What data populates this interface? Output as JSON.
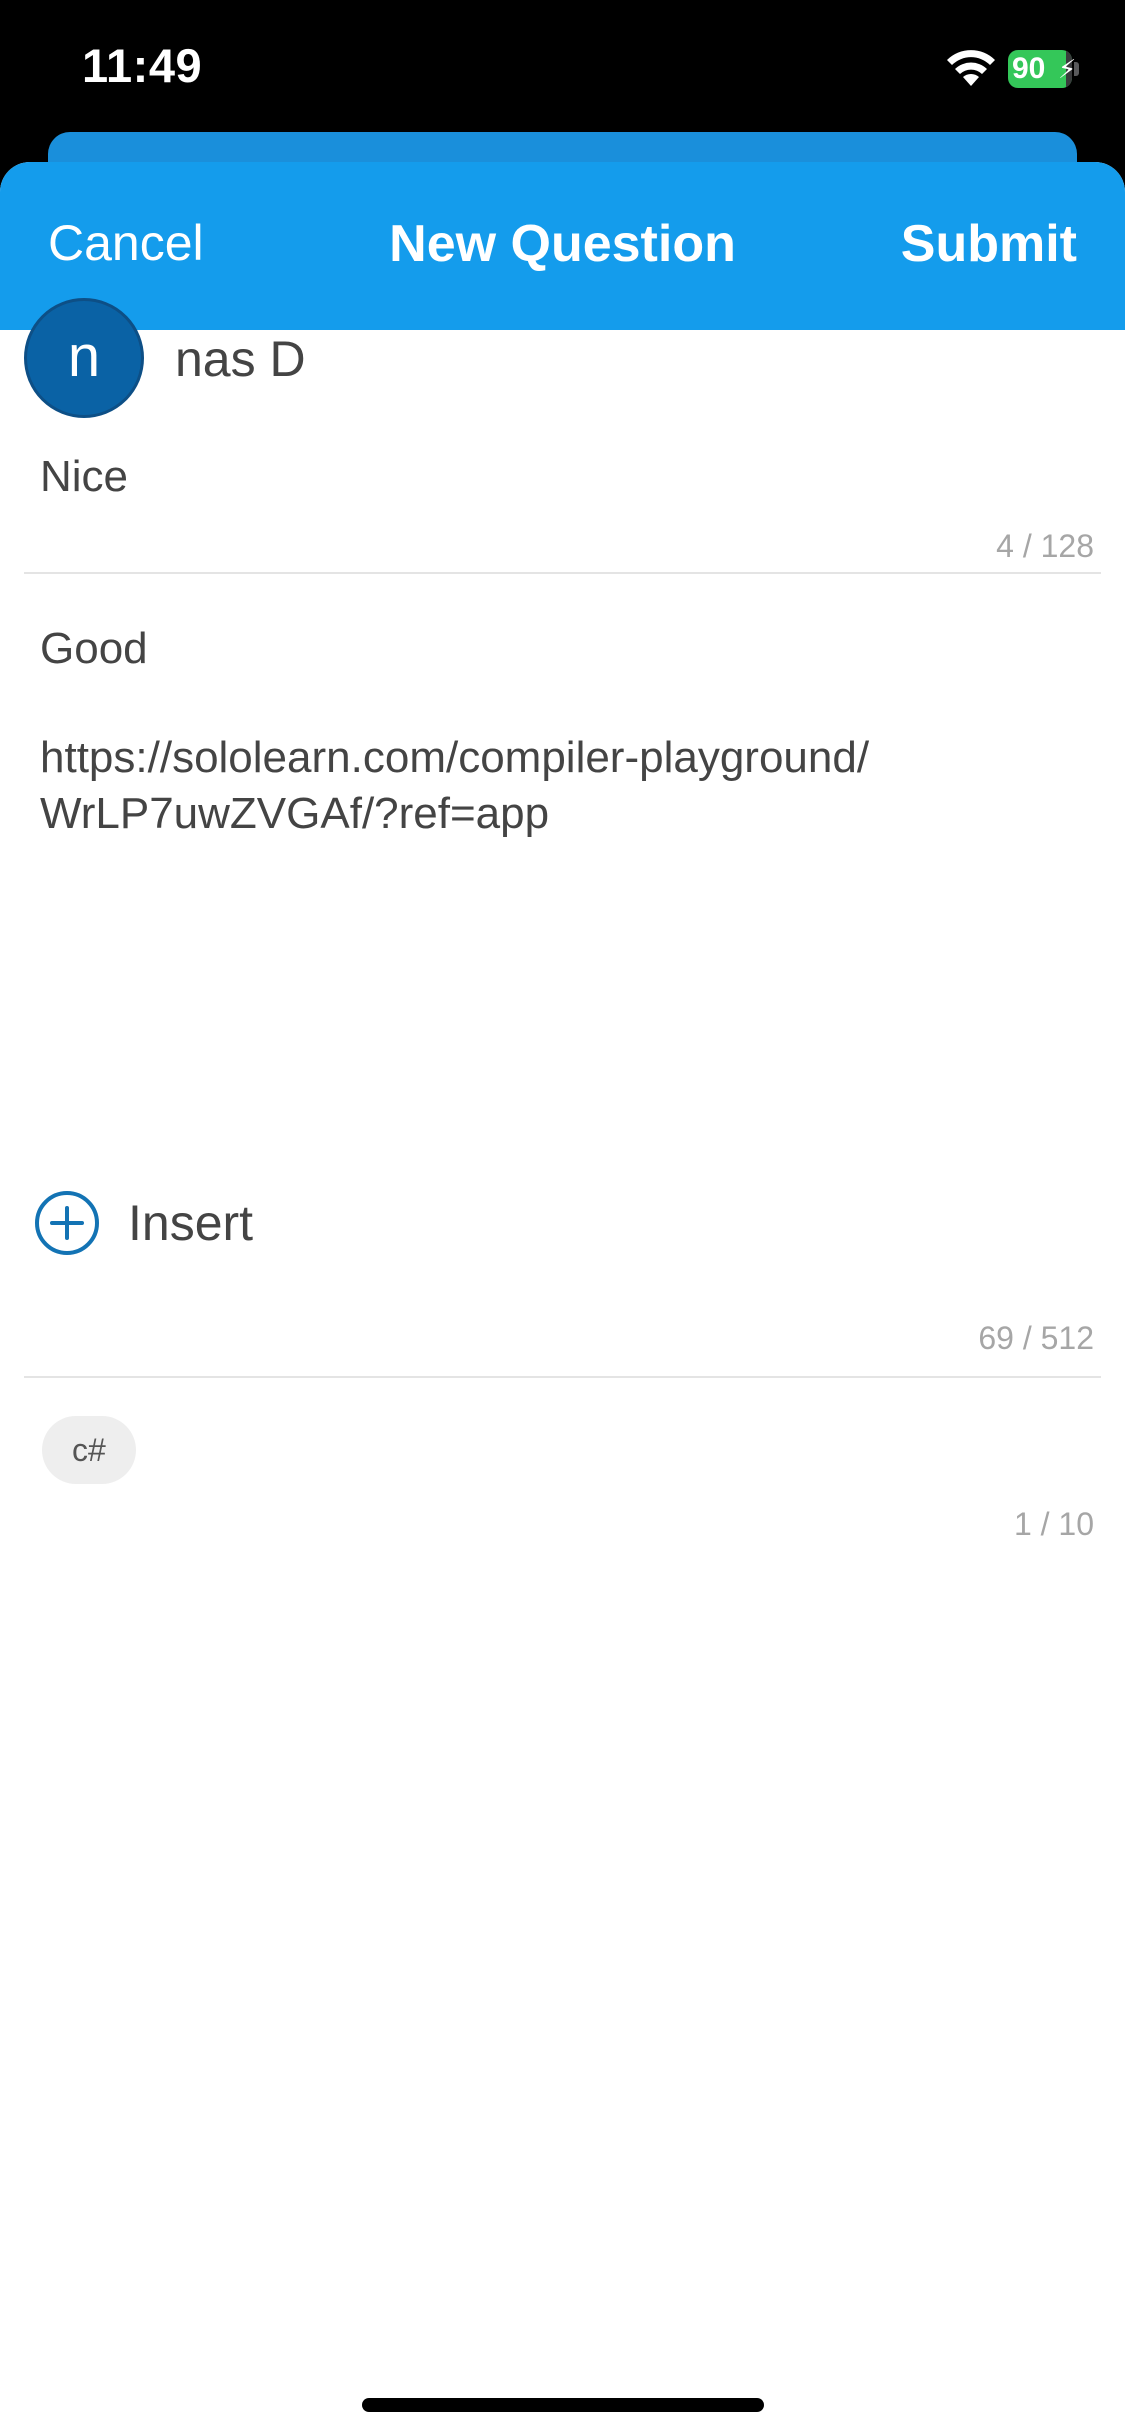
{
  "status_bar": {
    "time": "11:49",
    "battery_percent": 90,
    "battery_label": "90",
    "battery_color": "#34c759",
    "icons": [
      "wifi-icon",
      "battery-icon",
      "charging-bolt-icon"
    ]
  },
  "header": {
    "cancel_label": "Cancel",
    "title": "New Question",
    "submit_label": "Submit",
    "background_color": "#149cec"
  },
  "author": {
    "avatar_initial": "n",
    "avatar_color": "#0a62a5",
    "name": "nas D"
  },
  "question_title": {
    "value": "Nice",
    "counter": "4 / 128"
  },
  "description": {
    "line1": "Good",
    "link": "https://sololearn.com/compiler-playground/\nWrLP7uwZVGAf/?ref=app",
    "insert_label": "Insert",
    "insert_icon": "plus-circle-icon",
    "counter": "69 / 512"
  },
  "tags": {
    "items": [
      "c#"
    ],
    "counter": "1 / 10"
  }
}
